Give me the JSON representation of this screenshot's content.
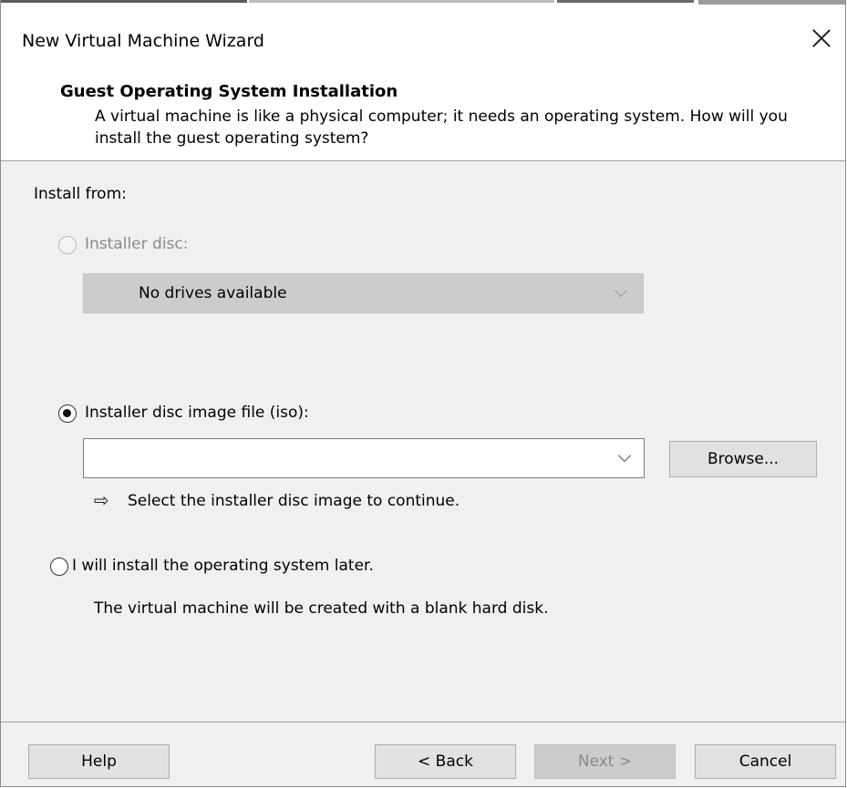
{
  "window": {
    "title": "New Virtual Machine Wizard"
  },
  "header": {
    "title": "Guest Operating System Installation",
    "description": "A virtual machine is like a physical computer; it needs an operating system. How will you install the guest operating system?"
  },
  "install_from": {
    "label": "Install from:",
    "options": [
      {
        "label": "Installer disc:",
        "selected": false,
        "enabled": false
      },
      {
        "label": "Installer disc image file (iso):",
        "selected": true,
        "enabled": true
      },
      {
        "label": "I will install the operating system later.",
        "selected": false,
        "enabled": true
      }
    ],
    "disc_drive": {
      "value": "No drives available"
    },
    "iso_path": {
      "value": ""
    },
    "browse_label": "Browse...",
    "iso_hint": "Select the installer disc image to continue.",
    "later_note": "The virtual machine will be created with a blank hard disk."
  },
  "footer": {
    "help": "Help",
    "back": "< Back",
    "next": "Next >",
    "cancel": "Cancel"
  }
}
